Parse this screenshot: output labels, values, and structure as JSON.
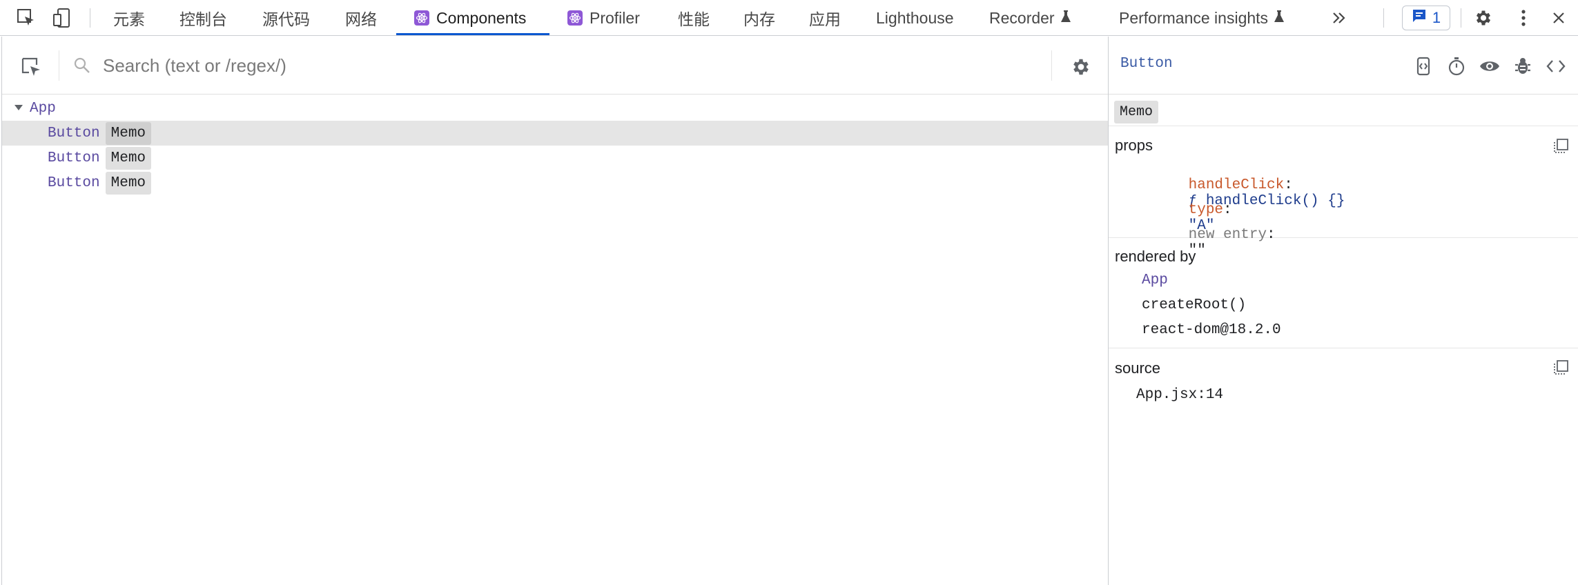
{
  "tabs": [
    {
      "label": "元素"
    },
    {
      "label": "控制台"
    },
    {
      "label": "源代码"
    },
    {
      "label": "网络"
    },
    {
      "label": "Components"
    },
    {
      "label": "Profiler"
    },
    {
      "label": "性能"
    },
    {
      "label": "内存"
    },
    {
      "label": "应用"
    },
    {
      "label": "Lighthouse"
    },
    {
      "label": "Recorder"
    },
    {
      "label": "Performance insights"
    }
  ],
  "active_tab": "Components",
  "issues_count": "1",
  "search": {
    "placeholder": "Search (text or /regex/)",
    "value": ""
  },
  "tree": {
    "root": "App",
    "children": [
      {
        "name": "Button",
        "badge": "Memo",
        "selected": true
      },
      {
        "name": "Button",
        "badge": "Memo",
        "selected": false
      },
      {
        "name": "Button",
        "badge": "Memo",
        "selected": false
      }
    ]
  },
  "inspector": {
    "title": "Button",
    "badge": "Memo",
    "props": {
      "title": "props",
      "items": [
        {
          "key": "handleClick",
          "sep": ":",
          "value": "ƒ handleClick() {}"
        },
        {
          "key": "type",
          "sep": ":",
          "value": "\"A\""
        },
        {
          "key": "new entry",
          "sep": ":",
          "value": "\"\""
        }
      ]
    },
    "rendered_by": {
      "title": "rendered by",
      "owner": "App",
      "items": [
        "createRoot()",
        "react-dom@18.2.0"
      ]
    },
    "source": {
      "title": "source",
      "file": "App.jsx:14"
    }
  },
  "colors": {
    "accent": "#0b57d0",
    "react_purple": "#8e58d6",
    "component": "#5a4aa0",
    "prop_key": "#c8582b"
  }
}
